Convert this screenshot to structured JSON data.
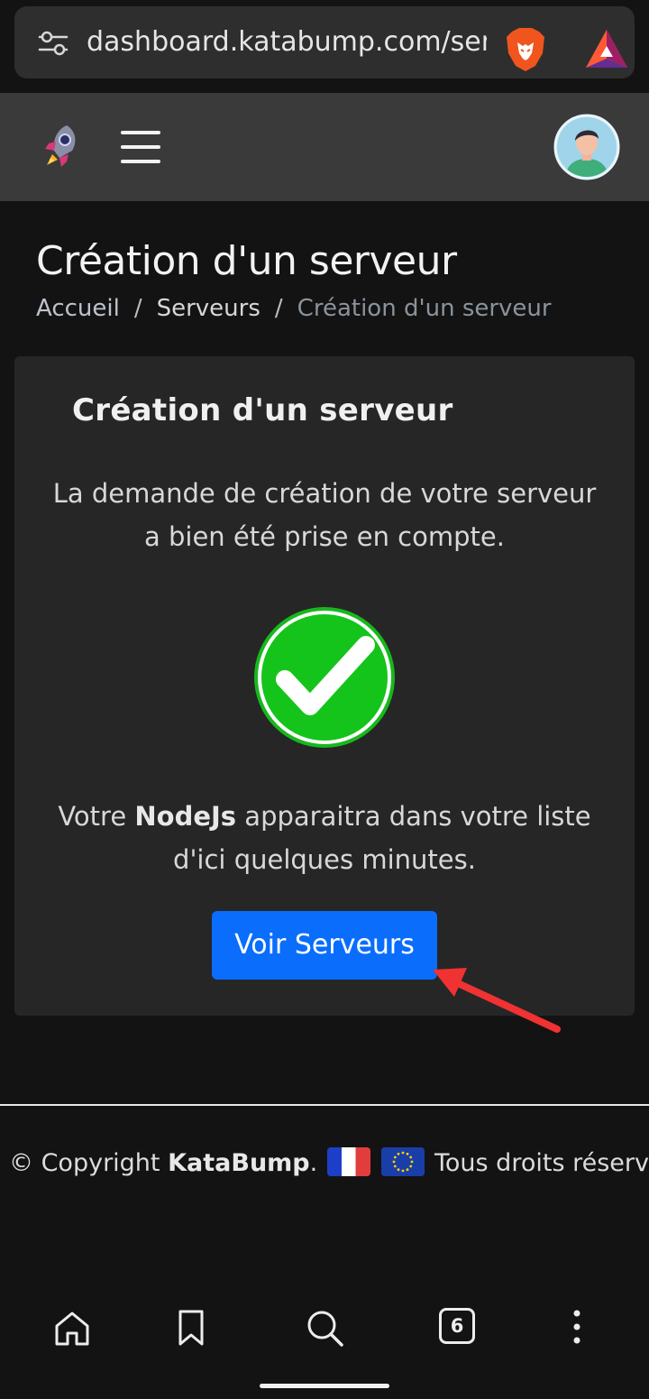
{
  "browser": {
    "url": "dashboard.katabump.com/serv",
    "tabs_count": "6"
  },
  "page": {
    "title": "Création d'un serveur",
    "breadcrumb": {
      "home": "Accueil",
      "servers": "Serveurs",
      "separator": "/",
      "current": "Création d'un serveur"
    }
  },
  "card": {
    "title": "Création d'un serveur",
    "message_1": "La demande de création de votre serveur a bien été prise en compte.",
    "message_2_prefix": "Votre ",
    "message_2_bold": "NodeJs",
    "message_2_suffix": " apparaitra dans votre liste d'ici quelques minutes.",
    "button_label": "Voir Serveurs"
  },
  "footer": {
    "copyright_prefix": "© Copyright ",
    "brand": "KataBump",
    "period": ".",
    "rights": "Tous droits réservés"
  },
  "colors": {
    "primary_button": "#0a6dfc",
    "success_check": "#14c41a",
    "annotation_arrow": "#f03232",
    "card_bg": "#262626",
    "page_bg": "#131313"
  },
  "icons": [
    "tune-icon",
    "brave-lion-icon",
    "bat-triangle-icon",
    "rocket-logo-icon",
    "hamburger-menu-icon",
    "avatar-icon",
    "success-check-icon",
    "home-icon",
    "bookmark-icon",
    "search-icon",
    "tabs-icon",
    "more-vertical-icon"
  ]
}
